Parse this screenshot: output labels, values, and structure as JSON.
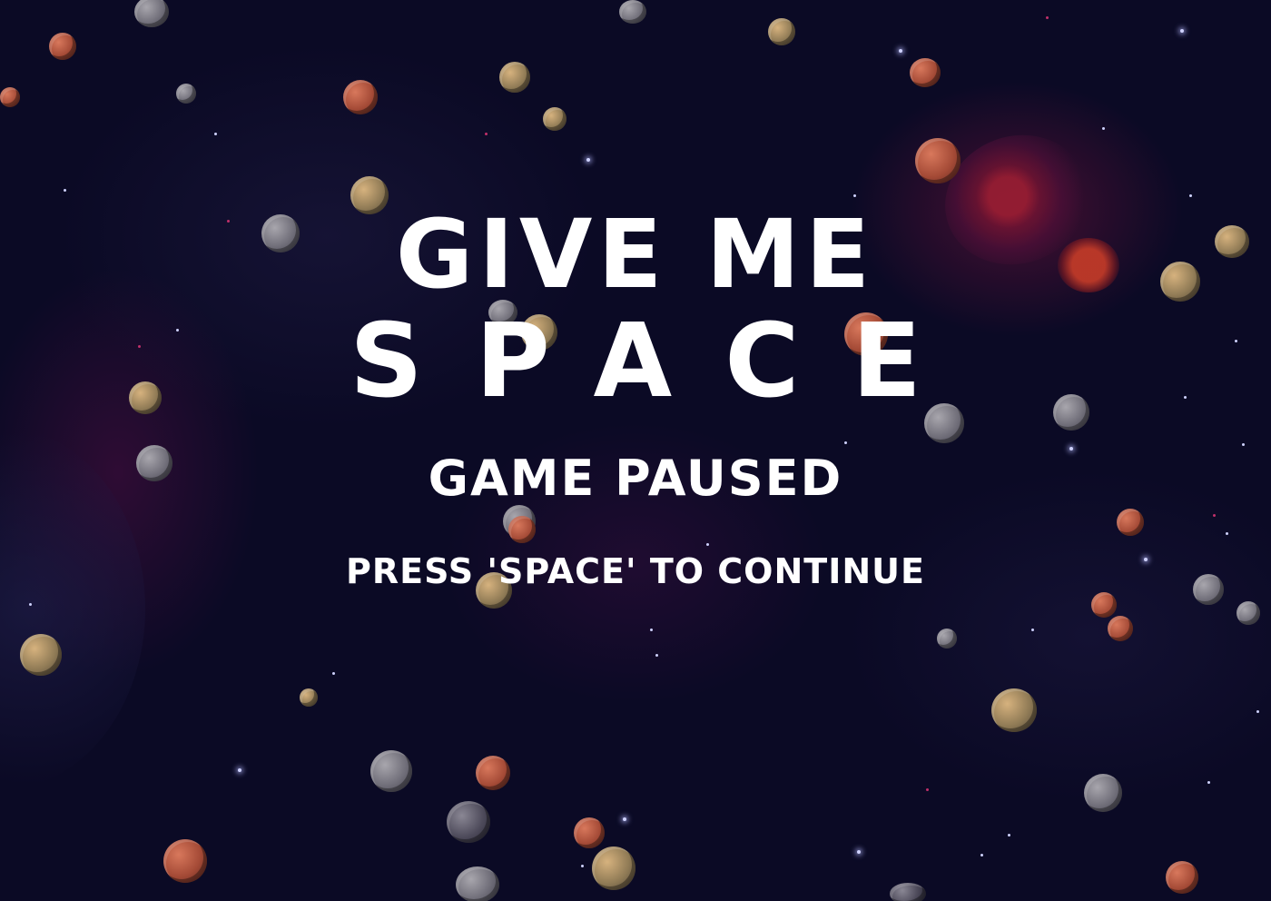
{
  "game": {
    "title_line1": "GIVE ME",
    "title_line2": "SPACE",
    "status": "GAME PAUSED",
    "prompt": "PRESS 'SPACE' TO CONTINUE"
  },
  "colors": {
    "background": "#0b0a25",
    "text": "#ffffff",
    "nebula": "#7a1440",
    "star": "#cfd2ff"
  }
}
